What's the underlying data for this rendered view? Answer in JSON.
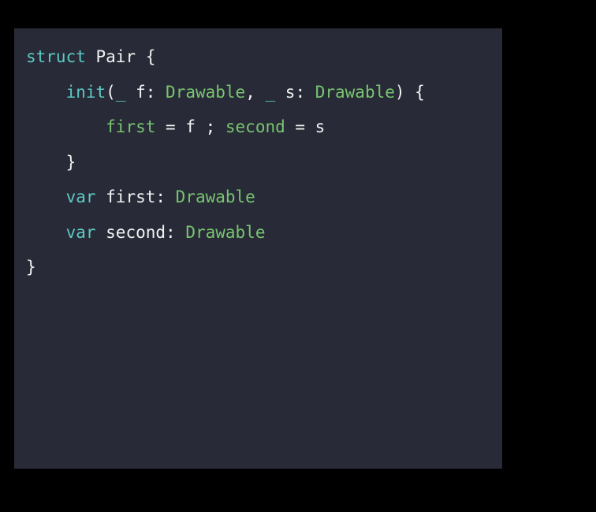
{
  "editor": {
    "background_color": "#000000",
    "panel_color": "#282b37",
    "language": "swift",
    "colors": {
      "keyword": "#5bc9c4",
      "type": "#78c470",
      "property": "#78c470",
      "plain": "#f2f2f2"
    },
    "code_text": "struct Pair {\n    init(_ f: Drawable, _ s: Drawable) {\n        first = f ; second = s\n    }\n    var first: Drawable\n    var second: Drawable\n}",
    "lines": [
      {
        "indent": "",
        "tokens": [
          {
            "text": "struct",
            "kind": "keyword"
          },
          {
            "text": " ",
            "kind": "plain"
          },
          {
            "text": "Pair",
            "kind": "plain"
          },
          {
            "text": " ",
            "kind": "plain"
          },
          {
            "text": "{",
            "kind": "plain"
          }
        ]
      },
      {
        "indent": "    ",
        "tokens": [
          {
            "text": "init",
            "kind": "keyword"
          },
          {
            "text": "(",
            "kind": "plain"
          },
          {
            "text": "_",
            "kind": "keyword"
          },
          {
            "text": " f: ",
            "kind": "plain"
          },
          {
            "text": "Drawable",
            "kind": "type"
          },
          {
            "text": ", ",
            "kind": "plain"
          },
          {
            "text": "_",
            "kind": "keyword"
          },
          {
            "text": " s: ",
            "kind": "plain"
          },
          {
            "text": "Drawable",
            "kind": "type"
          },
          {
            "text": ") {",
            "kind": "plain"
          }
        ]
      },
      {
        "indent": "        ",
        "tokens": [
          {
            "text": "first",
            "kind": "property"
          },
          {
            "text": " = f ; ",
            "kind": "plain"
          },
          {
            "text": "second",
            "kind": "property"
          },
          {
            "text": " = s",
            "kind": "plain"
          }
        ]
      },
      {
        "indent": "    ",
        "tokens": [
          {
            "text": "}",
            "kind": "plain"
          }
        ]
      },
      {
        "indent": "    ",
        "tokens": [
          {
            "text": "var",
            "kind": "keyword"
          },
          {
            "text": " first: ",
            "kind": "plain"
          },
          {
            "text": "Drawable",
            "kind": "type"
          }
        ]
      },
      {
        "indent": "    ",
        "tokens": [
          {
            "text": "var",
            "kind": "keyword"
          },
          {
            "text": " second: ",
            "kind": "plain"
          },
          {
            "text": "Drawable",
            "kind": "type"
          }
        ]
      },
      {
        "indent": "",
        "tokens": [
          {
            "text": "}",
            "kind": "plain"
          }
        ]
      }
    ]
  }
}
